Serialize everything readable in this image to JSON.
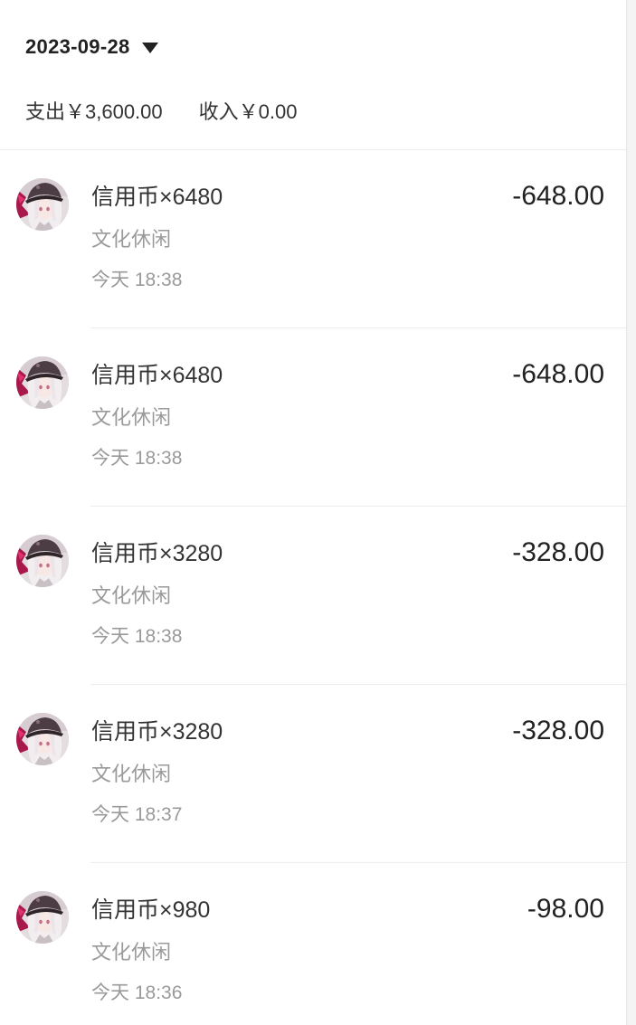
{
  "header": {
    "date": "2023-09-28",
    "expense": "支出￥3,600.00",
    "income": "收入￥0.00"
  },
  "icons": {
    "dropdown": "triangle-down-icon",
    "avatar": "anime-character-avatar"
  },
  "transactions": [
    {
      "title": "信用币×6480",
      "category": "文化休闲",
      "time": "今天 18:38",
      "amount": "-648.00"
    },
    {
      "title": "信用币×6480",
      "category": "文化休闲",
      "time": "今天 18:38",
      "amount": "-648.00"
    },
    {
      "title": "信用币×3280",
      "category": "文化休闲",
      "time": "今天 18:38",
      "amount": "-328.00"
    },
    {
      "title": "信用币×3280",
      "category": "文化休闲",
      "time": "今天 18:37",
      "amount": "-328.00"
    },
    {
      "title": "信用币×980",
      "category": "文化休闲",
      "time": "今天 18:36",
      "amount": "-98.00"
    }
  ],
  "colors": {
    "primary_text": "#333333",
    "strong_text": "#222222",
    "secondary_text": "#9a9a9a",
    "divider": "#ececec",
    "background": "#ffffff"
  }
}
